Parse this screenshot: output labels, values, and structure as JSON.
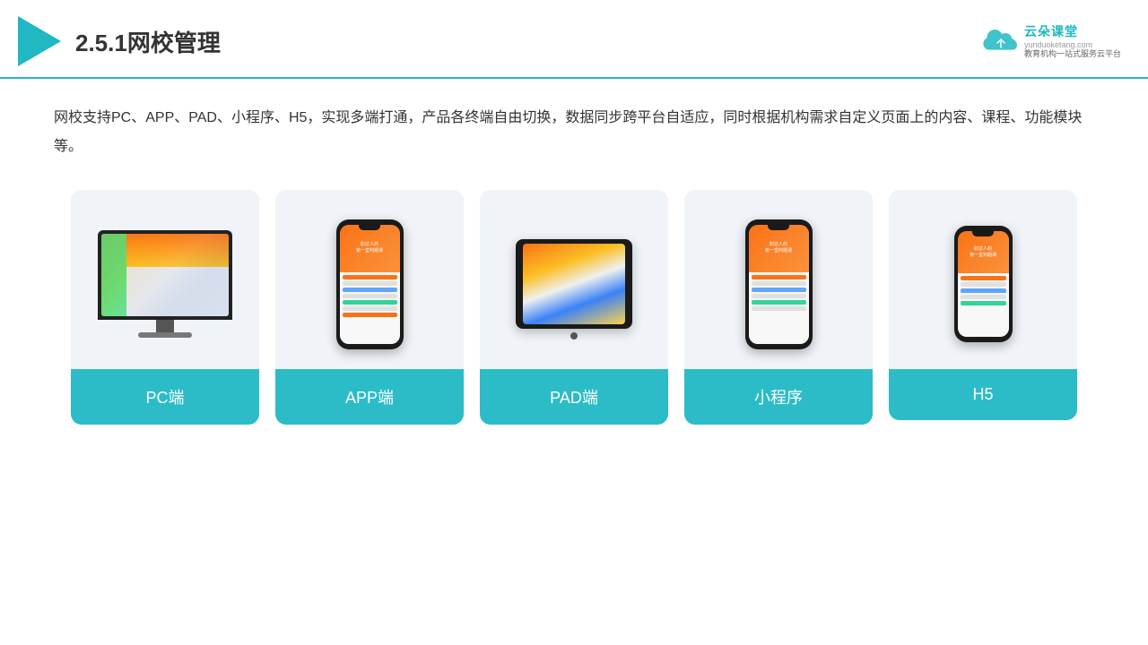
{
  "header": {
    "title": "2.5.1网校管理",
    "brand": {
      "name": "云朵课堂",
      "romanized": "yunduoketang.com",
      "slogan_line1": "教育机构一站",
      "slogan_line2": "式服务云平台"
    }
  },
  "description": "网校支持PC、APP、PAD、小程序、H5，实现多端打通，产品各终端自由切换，数据同步跨平台自适应，同时根据机构需求自定义页面上的内容、课程、功能模块等。",
  "cards": [
    {
      "id": "pc",
      "label": "PC端"
    },
    {
      "id": "app",
      "label": "APP端"
    },
    {
      "id": "pad",
      "label": "PAD端"
    },
    {
      "id": "miniprogram",
      "label": "小程序"
    },
    {
      "id": "h5",
      "label": "H5"
    }
  ],
  "colors": {
    "accent": "#2bbcc7",
    "header_border": "#1fb8c3",
    "card_bg": "#f0f4f8",
    "label_bg": "#2bbcc7",
    "label_text": "#ffffff",
    "title_color": "#333333",
    "desc_color": "#333333"
  }
}
